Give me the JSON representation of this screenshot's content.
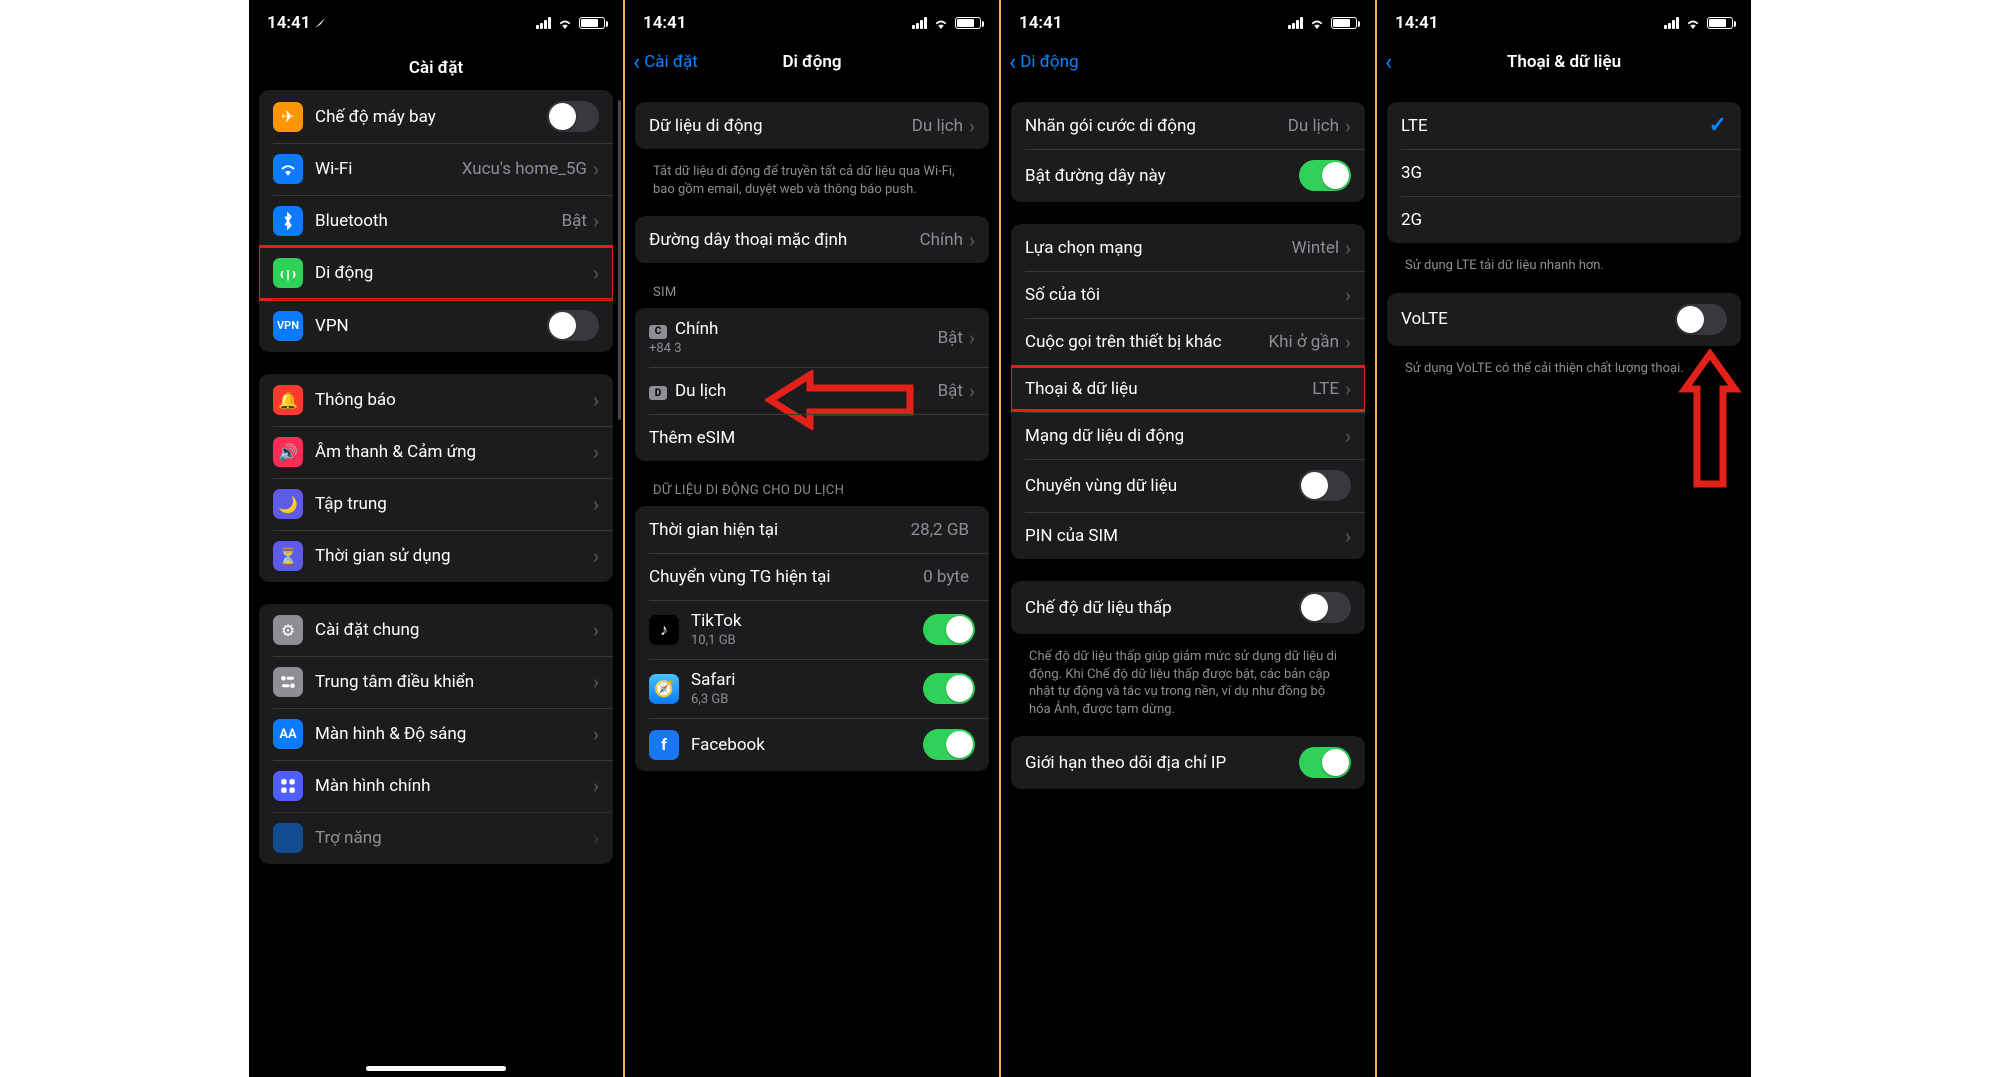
{
  "status": {
    "time": "14:41"
  },
  "screen1": {
    "title": "Cài đặt",
    "group1": [
      {
        "label": "Chế độ máy bay",
        "icon": "airplane",
        "color": "#ff9500",
        "toggle": false
      },
      {
        "label": "Wi-Fi",
        "icon": "wifi",
        "color": "#0a7aff",
        "value": "Xucu's home_5G"
      },
      {
        "label": "Bluetooth",
        "icon": "bluetooth",
        "color": "#0a7aff",
        "value": "Bật"
      },
      {
        "label": "Di động",
        "icon": "antenna",
        "color": "#30d158",
        "highlight": true
      },
      {
        "label": "VPN",
        "icon": "vpn",
        "color": "#0a7aff",
        "toggle": false
      }
    ],
    "group2": [
      {
        "label": "Thông báo",
        "icon": "bell",
        "color": "#ff3b30"
      },
      {
        "label": "Âm thanh & Cảm ứng",
        "icon": "speaker",
        "color": "#ff2d55"
      },
      {
        "label": "Tập trung",
        "icon": "moon",
        "color": "#5e5ce6"
      },
      {
        "label": "Thời gian sử dụng",
        "icon": "hourglass",
        "color": "#5e5ce6"
      }
    ],
    "group3": [
      {
        "label": "Cài đặt chung",
        "icon": "gear",
        "color": "#8e8e93"
      },
      {
        "label": "Trung tâm điều khiển",
        "icon": "controls",
        "color": "#8e8e93"
      },
      {
        "label": "Màn hình & Độ sáng",
        "icon": "aa",
        "color": "#0a7aff"
      },
      {
        "label": "Màn hình chính",
        "icon": "grid",
        "color": "#4f5eff"
      },
      {
        "label": "Trợ năng",
        "icon": "access",
        "color": "#0a7aff"
      }
    ]
  },
  "screen2": {
    "back": "Cài đặt",
    "title": "Di động",
    "mobile_data": {
      "label": "Dữ liệu di động",
      "value": "Du lịch"
    },
    "note1": "Tắt dữ liệu di động để truyền tất cả dữ liệu qua Wi-Fi, bao gồm email, duyệt web và thông báo push.",
    "default_line": {
      "label": "Đường dây thoại mặc định",
      "value": "Chính"
    },
    "sim_header": "SIM",
    "sim1": {
      "badge": "C",
      "label": "Chính",
      "sub": "+84 3",
      "value": "Bật"
    },
    "sim2": {
      "badge": "D",
      "label": "Du lịch",
      "value": "Bật"
    },
    "add_esim": "Thêm eSIM",
    "data_header": "DỮ LIỆU DI ĐỘNG CHO DU LỊCH",
    "current_period": {
      "label": "Thời gian hiện tại",
      "value": "28,2 GB"
    },
    "roaming": {
      "label": "Chuyển vùng TG hiện tại",
      "value": "0 byte"
    },
    "apps": [
      {
        "label": "TikTok",
        "sub": "10,1 GB",
        "icon": "tiktok",
        "color": "#000",
        "toggle": true
      },
      {
        "label": "Safari",
        "sub": "6,3 GB",
        "icon": "safari",
        "color": "#0a7aff",
        "toggle": true
      },
      {
        "label": "Facebook",
        "sub": "",
        "icon": "facebook",
        "color": "#1877f2",
        "toggle": true
      }
    ]
  },
  "screen3": {
    "back": "Di động",
    "rows1": [
      {
        "label": "Nhãn gói cước di động",
        "value": "Du lịch"
      },
      {
        "label": "Bật đường dây này",
        "toggle": true
      }
    ],
    "rows2": [
      {
        "label": "Lựa chọn mạng",
        "value": "Wintel"
      },
      {
        "label": "Số của tôi"
      },
      {
        "label": "Cuộc gọi trên thiết bị khác",
        "value": "Khi ở gần"
      },
      {
        "label": "Thoại & dữ liệu",
        "value": "LTE",
        "highlight": true
      },
      {
        "label": "Mạng dữ liệu di động"
      },
      {
        "label": "Chuyển vùng dữ liệu",
        "toggle": false
      },
      {
        "label": "PIN của SIM"
      }
    ],
    "rows3": [
      {
        "label": "Chế độ dữ liệu thấp",
        "toggle": false
      }
    ],
    "note3": "Chế độ dữ liệu thấp giúp giảm mức sử dụng dữ liệu di động. Khi Chế độ dữ liệu thấp được bật, các bản cập nhật tự động và tác vụ trong nền, ví dụ như đồng bộ hóa Ảnh, được tạm dừng.",
    "rows4": [
      {
        "label": "Giới hạn theo dõi địa chỉ IP",
        "toggle": true
      }
    ]
  },
  "screen4": {
    "title": "Thoại & dữ liệu",
    "options": [
      {
        "label": "LTE",
        "checked": true
      },
      {
        "label": "3G"
      },
      {
        "label": "2G"
      }
    ],
    "note1": "Sử dụng LTE tải dữ liệu nhanh hơn.",
    "volte": {
      "label": "VoLTE",
      "toggle": false,
      "highlight": true
    },
    "note2": "Sử dụng VoLTE có thể cải thiện chất lượng thoại."
  }
}
